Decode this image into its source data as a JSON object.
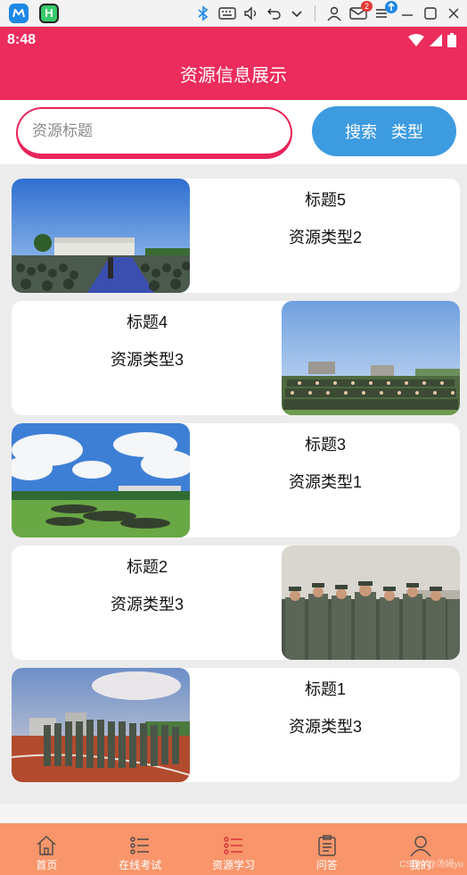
{
  "status": {
    "time": "8:48"
  },
  "osbar": {
    "notification_count": "2"
  },
  "header": {
    "title": "资源信息展示"
  },
  "search": {
    "placeholder": "资源标题",
    "value": "",
    "button_search": "搜索",
    "button_type": "类型"
  },
  "resources": [
    {
      "title": "标题5",
      "type": "资源类型2",
      "image_side": "left",
      "photo": "assembly-field"
    },
    {
      "title": "标题4",
      "type": "资源类型3",
      "image_side": "right",
      "photo": "group-photo"
    },
    {
      "title": "标题3",
      "type": "资源类型1",
      "image_side": "left",
      "photo": "lawn-sky"
    },
    {
      "title": "标题2",
      "type": "资源类型3",
      "image_side": "right",
      "photo": "soldiers-closeup"
    },
    {
      "title": "标题1",
      "type": "资源类型3",
      "image_side": "left",
      "photo": "track-line"
    }
  ],
  "tabs": [
    {
      "label": "首页",
      "icon": "home-icon"
    },
    {
      "label": "在线考试",
      "icon": "list-icon"
    },
    {
      "label": "资源学习",
      "icon": "list-icon"
    },
    {
      "label": "问答",
      "icon": "clipboard-icon"
    },
    {
      "label": "我的",
      "icon": "user-icon"
    }
  ],
  "watermark": "CSDN @汤姆yu",
  "colors": {
    "primary": "#eb2c5c",
    "accent": "#3d9be0",
    "tabbar": "#f8956a"
  }
}
